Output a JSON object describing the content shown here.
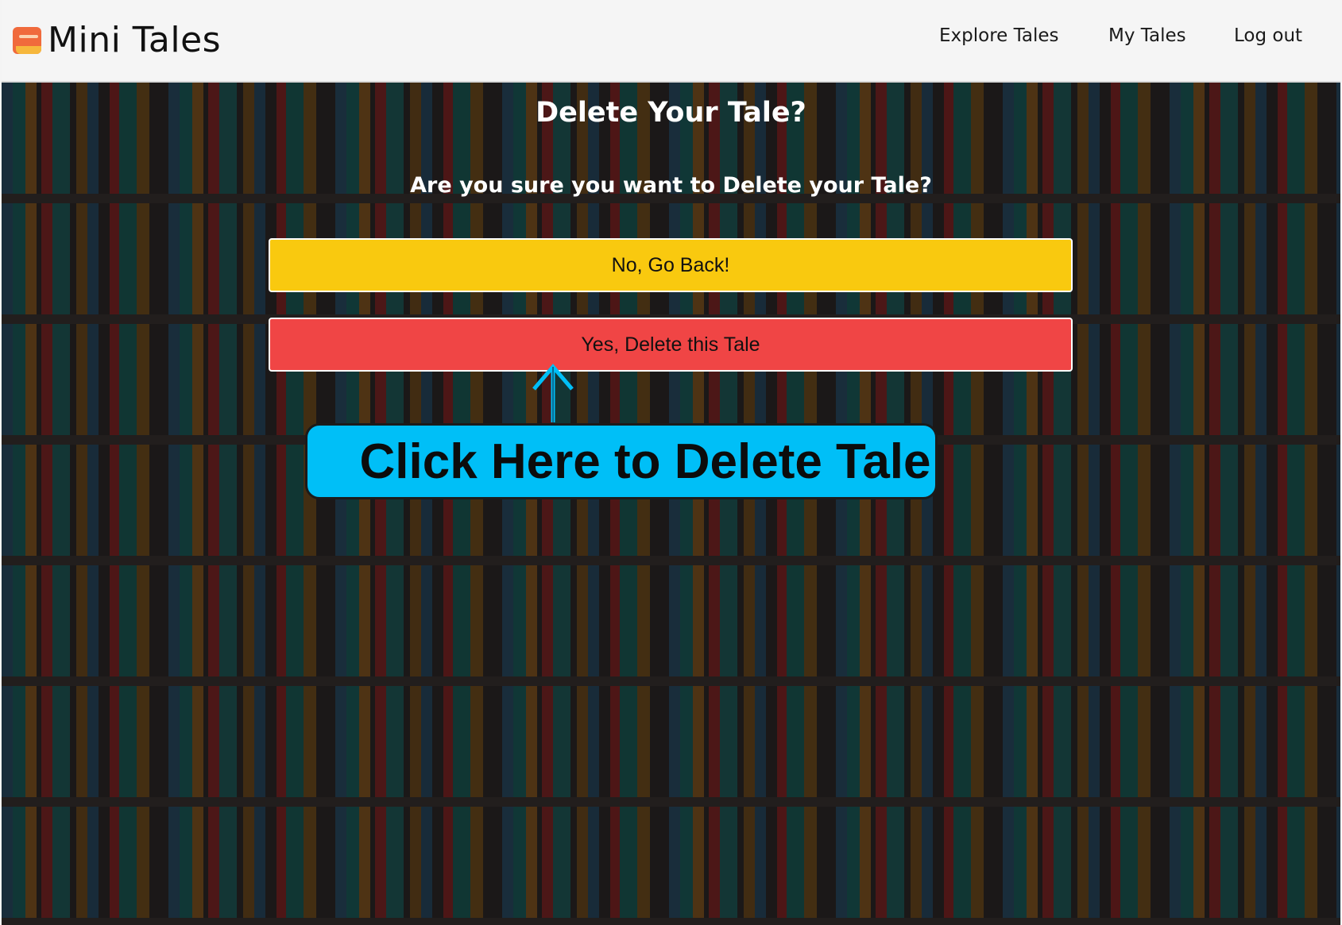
{
  "header": {
    "brand": "Mini Tales",
    "nav": {
      "explore": "Explore Tales",
      "my_tales": "My Tales",
      "logout": "Log out"
    }
  },
  "main": {
    "title": "Delete Your Tale?",
    "question": "Are you sure you want to Delete your Tale?",
    "back_button": "No, Go Back!",
    "delete_button": "Yes, Delete this Tale"
  },
  "annotation": {
    "callout_text": "Click Here to Delete Tale"
  },
  "colors": {
    "back_button_bg": "#f9c90f",
    "delete_button_bg": "#f04545",
    "callout_bg": "#00bff7",
    "arrow": "#00bff7"
  },
  "icons": {
    "brand": "book-icon",
    "arrow": "arrow-up-icon"
  }
}
